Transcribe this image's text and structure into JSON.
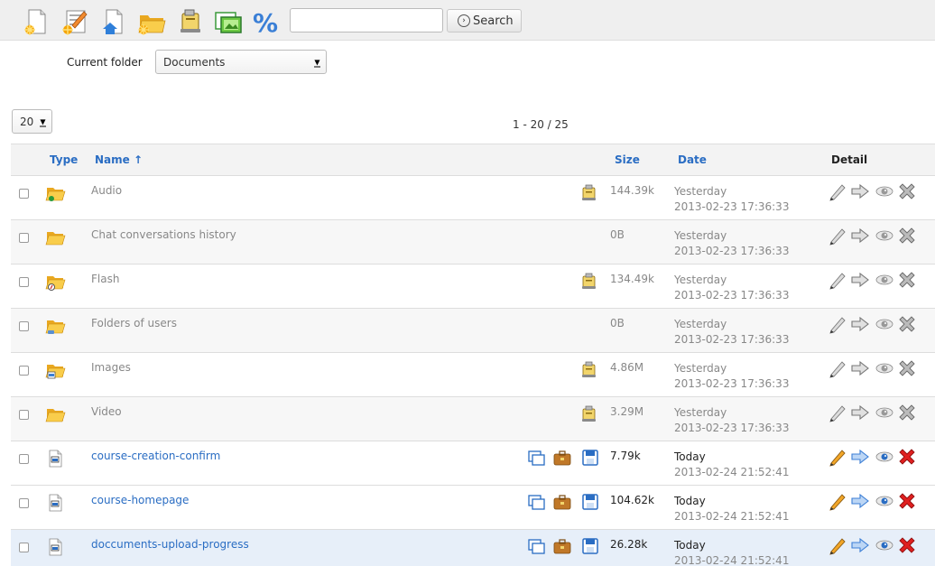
{
  "toolbar": {
    "icons": [
      "new-document-icon",
      "create-draft-icon",
      "home-icon",
      "new-folder-icon",
      "upload-icon",
      "slideshow-icon",
      "quota-icon"
    ],
    "search_placeholder": "",
    "search_button": "Search"
  },
  "folder": {
    "label": "Current folder",
    "selected": "Documents"
  },
  "paging": {
    "per_page": "20",
    "range": "1 - 20 / 25"
  },
  "table": {
    "headers": {
      "type": "Type",
      "name": "Name ↑",
      "size": "Size",
      "date": "Date",
      "detail": "Detail"
    },
    "rows": [
      {
        "name": "Audio",
        "kind": "folder",
        "badge": "audio",
        "size": "144.39k",
        "date_rel": "Yesterday",
        "date_abs": "2013-02-23 17:36:33",
        "zip": true
      },
      {
        "name": "Chat conversations history",
        "kind": "folder",
        "badge": "",
        "size": "0B",
        "date_rel": "Yesterday",
        "date_abs": "2013-02-23 17:36:33",
        "zip": false
      },
      {
        "name": "Flash",
        "kind": "folder",
        "badge": "flash",
        "size": "134.49k",
        "date_rel": "Yesterday",
        "date_abs": "2013-02-23 17:36:33",
        "zip": true
      },
      {
        "name": "Folders of users",
        "kind": "folder",
        "badge": "users",
        "size": "0B",
        "date_rel": "Yesterday",
        "date_abs": "2013-02-23 17:36:33",
        "zip": false
      },
      {
        "name": "Images",
        "kind": "folder",
        "badge": "images",
        "size": "4.86M",
        "date_rel": "Yesterday",
        "date_abs": "2013-02-23 17:36:33",
        "zip": true
      },
      {
        "name": "Video",
        "kind": "folder",
        "badge": "",
        "size": "3.29M",
        "date_rel": "Yesterday",
        "date_abs": "2013-02-23 17:36:33",
        "zip": true
      },
      {
        "name": "course-creation-confirm",
        "kind": "image",
        "size": "7.79k",
        "date_rel": "Today",
        "date_abs": "2013-02-24 21:52:41"
      },
      {
        "name": "course-homepage",
        "kind": "image",
        "size": "104.62k",
        "date_rel": "Today",
        "date_abs": "2013-02-24 21:52:41"
      },
      {
        "name": "doccuments-upload-progress",
        "kind": "image",
        "size": "26.28k",
        "date_rel": "Today",
        "date_abs": "2013-02-24 21:52:41"
      }
    ]
  },
  "colors": {
    "link": "#2a6dc3",
    "folder_yellow": "#f6c238",
    "delete_red": "#e02020",
    "edit_orange": "#f2a628",
    "move_blue": "#3d7fd6",
    "highlight_row": "#e7eff9"
  }
}
